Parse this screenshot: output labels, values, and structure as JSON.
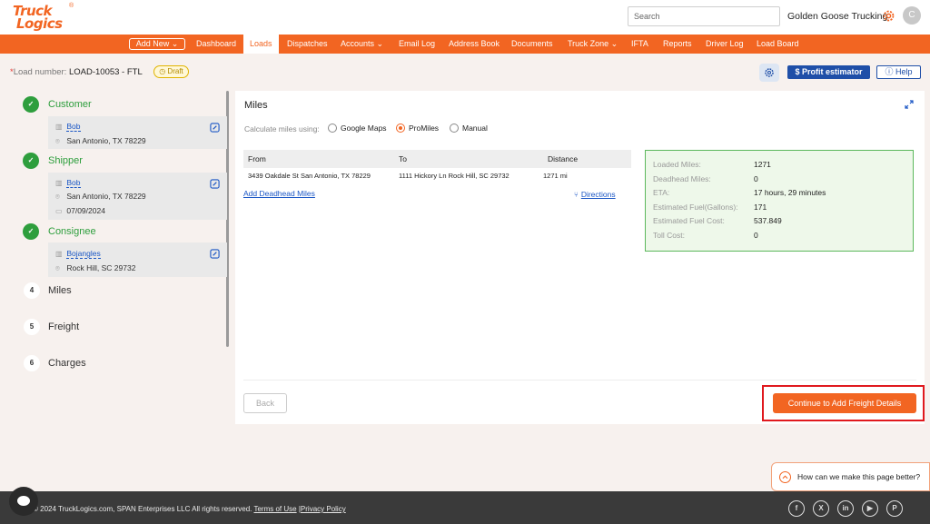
{
  "header": {
    "logo_line1": "Truck",
    "logo_line2": "Logics",
    "logo_reg": "®",
    "search_placeholder": "Search",
    "company": "Golden Goose Trucking",
    "avatar_letter": "C"
  },
  "nav": {
    "add_new": "Add New ⌄",
    "items": [
      "Dashboard",
      "Loads",
      "Dispatches",
      "Accounts ⌄",
      "Email Log",
      "Address Book",
      "Documents",
      "Truck Zone ⌄",
      "IFTA",
      "Reports",
      "Driver Log",
      "Load Board"
    ],
    "active": "Loads"
  },
  "load": {
    "required_mark": "*",
    "label": "Load number:",
    "number": "LOAD-10053 - FTL",
    "status": "Draft",
    "profit_estimator": "Profit estimator",
    "help": "Help"
  },
  "steps": {
    "customer": {
      "number": "1",
      "title": "Customer",
      "name": "Bob",
      "address": "San Antonio, TX 78229"
    },
    "shipper": {
      "number": "2",
      "title": "Shipper",
      "name": "Bob",
      "address": "San Antonio, TX 78229",
      "date": "07/09/2024"
    },
    "consignee": {
      "number": "3",
      "title": "Consignee",
      "name": "Bojangles",
      "address": "Rock Hill, SC 29732"
    },
    "miles": {
      "number": "4",
      "title": "Miles"
    },
    "freight": {
      "number": "5",
      "title": "Freight"
    },
    "charges": {
      "number": "6",
      "title": "Charges"
    }
  },
  "miles": {
    "title": "Miles",
    "calc_label": "Calculate miles using:",
    "options": [
      "Google Maps",
      "ProMiles",
      "Manual"
    ],
    "selected": "ProMiles",
    "table": {
      "headers": [
        "From",
        "To",
        "Distance"
      ],
      "row": [
        "3439 Oakdale St San Antonio, TX 78229",
        "1111 Hickory Ln Rock Hill, SC 29732",
        "1271 mi"
      ]
    },
    "add_deadhead": "Add Deadhead Miles",
    "directions": "Directions",
    "summary": {
      "loaded_label": "Loaded Miles:",
      "loaded": "1271",
      "deadhead_label": "Deadhead Miles:",
      "deadhead": "0",
      "eta_label": "ETA:",
      "eta": "17 hours, 29 minutes",
      "fuel_gal_label": "Estimated Fuel(Gallons):",
      "fuel_gal": "171",
      "fuel_cost_label": "Estimated Fuel Cost:",
      "fuel_cost": "537.849",
      "toll_label": "Toll Cost:",
      "toll": "0"
    },
    "back": "Back",
    "continue": "Continue to Add Freight Details"
  },
  "feedback": "How can we make this page better?",
  "footer": {
    "copyright": "© 2024 TruckLogics.com, SPAN Enterprises LLC All rights reserved.",
    "terms": "Terms of Use",
    "sep": "|",
    "privacy": "Privacy Policy",
    "social": [
      "f",
      "X",
      "in",
      "▶",
      "P"
    ]
  },
  "colors": {
    "brand": "#f26522",
    "accent_blue": "#1f4fa8",
    "success": "#2e9e3d",
    "highlight": "#e0191e"
  }
}
